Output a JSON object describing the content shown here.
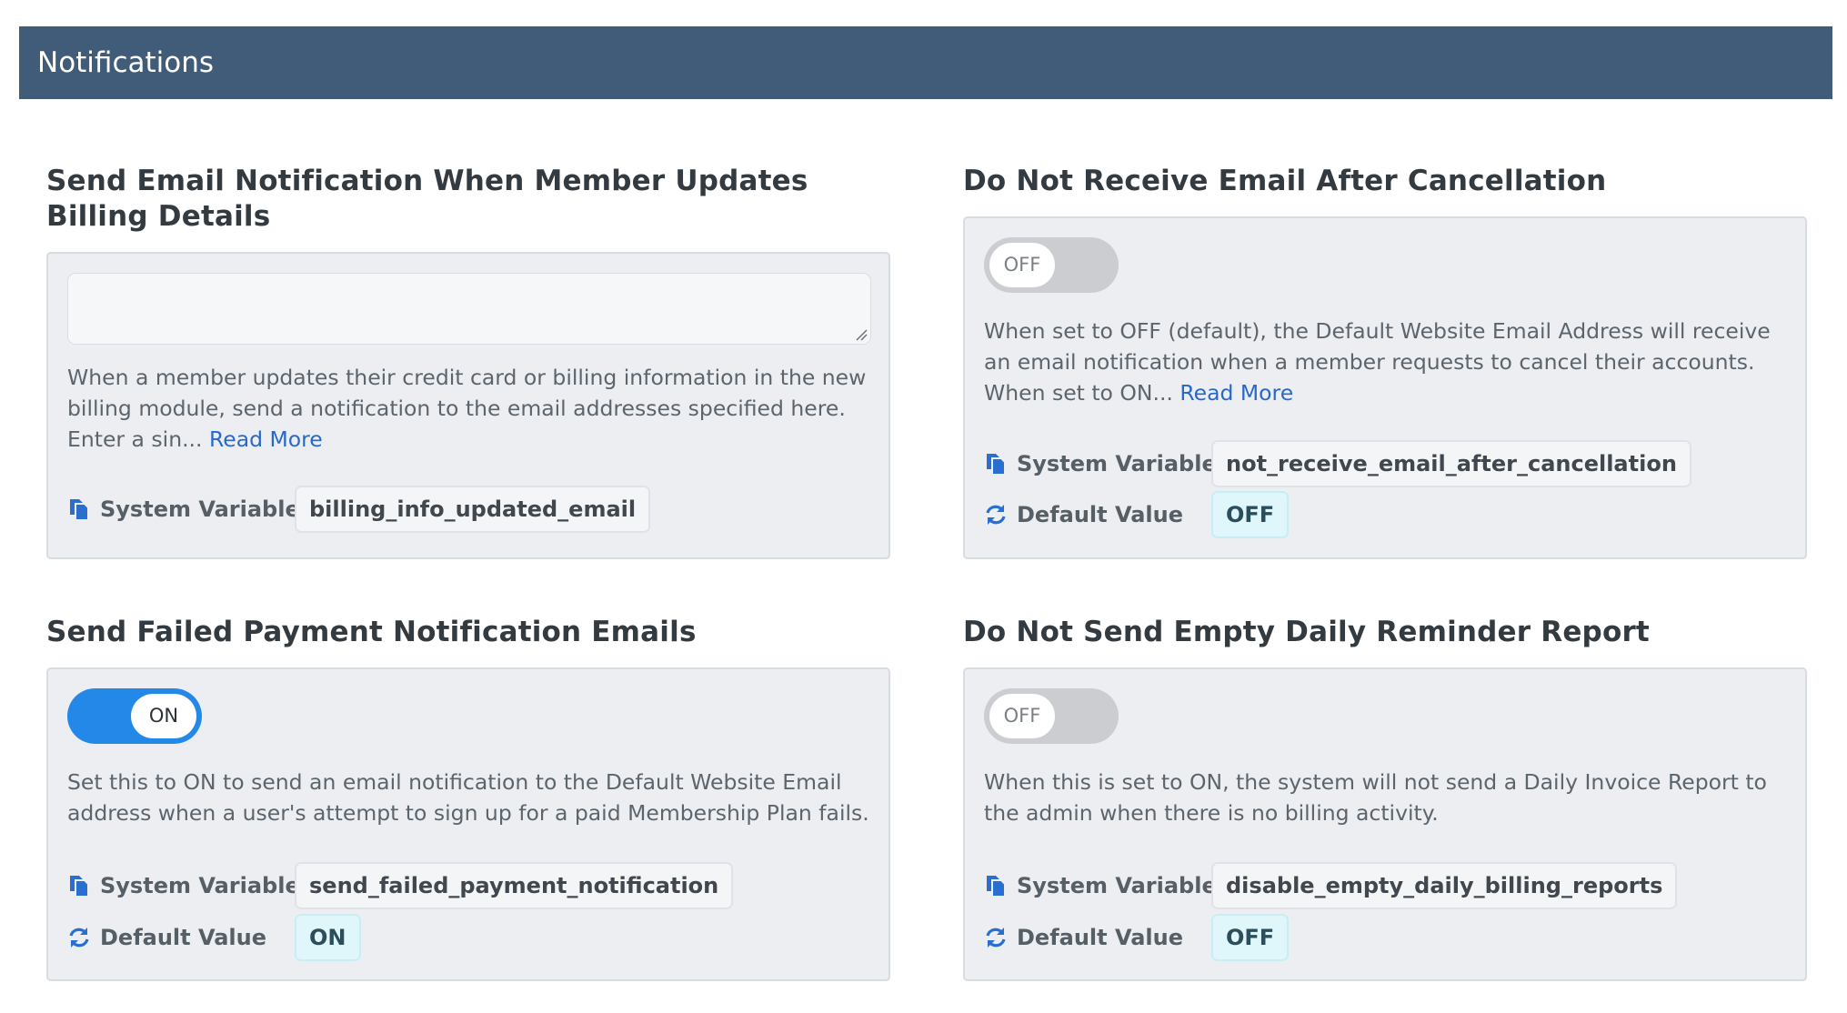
{
  "header": {
    "title": "Notifications"
  },
  "settings": {
    "billing_email": {
      "title": "Send Email Notification When Member Updates Billing Details",
      "input_value": "",
      "description": "When a member updates their credit card or billing information in the new billing module, send a notification to the email addresses specified here. Enter a sin...",
      "read_more": "Read More",
      "system_variable_label": "System Variable",
      "system_variable": "billing_info_updated_email"
    },
    "no_email_cancel": {
      "title": "Do Not Receive Email After Cancellation",
      "toggle_state": "OFF",
      "description": "When set to OFF (default), the Default Website Email Address will receive an email notification when a member requests to cancel their accounts.  When set to ON...",
      "read_more": "Read More",
      "system_variable_label": "System Variable",
      "system_variable": "not_receive_email_after_cancellation",
      "default_value_label": "Default Value",
      "default_value": "OFF"
    },
    "failed_payment": {
      "title": "Send Failed Payment Notification Emails",
      "toggle_state": "ON",
      "description": "Set this to ON to send an email notification to the Default Website Email address when a user's attempt to sign up for a paid Membership Plan fails.",
      "system_variable_label": "System Variable",
      "system_variable": "send_failed_payment_notification",
      "default_value_label": "Default Value",
      "default_value": "ON"
    },
    "empty_report": {
      "title": "Do Not Send Empty Daily Reminder Report",
      "toggle_state": "OFF",
      "description": "When this is set to ON, the system will not send a Daily Invoice Report to the admin when there is no billing activity.",
      "system_variable_label": "System Variable",
      "system_variable": "disable_empty_daily_billing_reports",
      "default_value_label": "Default Value",
      "default_value": "OFF"
    }
  },
  "icons": {
    "system_variable": "copy-icon",
    "default_value": "refresh-icon"
  },
  "colors": {
    "header": "#405c78",
    "accent": "#2388e8",
    "link": "#2868c8",
    "value_pill": "#dff6fb"
  }
}
